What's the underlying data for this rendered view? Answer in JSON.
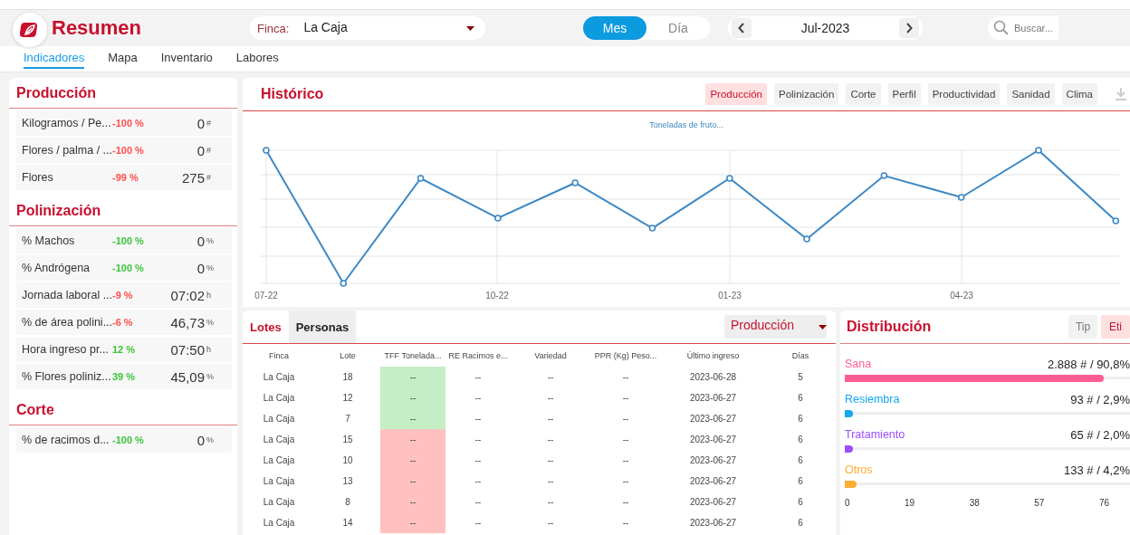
{
  "header": {
    "title": "Resumen",
    "finca": {
      "label": "Finca:",
      "value": "La Caja"
    },
    "period_toggle": [
      {
        "label": "Mes",
        "selected": true
      },
      {
        "label": "Día",
        "selected": false
      }
    ],
    "date": "Jul-2023",
    "search": {
      "placeholder": "Buscar..."
    }
  },
  "tabs": [
    {
      "label": "Indicadores",
      "selected": true
    },
    {
      "label": "Mapa",
      "selected": false
    },
    {
      "label": "Inventario",
      "selected": false
    },
    {
      "label": "Labores",
      "selected": false
    }
  ],
  "indicator_sections": [
    {
      "title": "Producción",
      "items": [
        {
          "label": "Kilogramos / Pe...",
          "change": "-100 %",
          "color": "#ff4d4f",
          "value": "0",
          "unit": "#"
        },
        {
          "label": "Flores / palma / ...",
          "change": "-100 %",
          "color": "#ff4d4f",
          "value": "0",
          "unit": "#"
        },
        {
          "label": "Flores",
          "change": "-99 %",
          "color": "#ff4d4f",
          "value": "275",
          "unit": "#"
        }
      ]
    },
    {
      "title": "Polinización",
      "items": [
        {
          "label": "% Machos",
          "change": "-100 %",
          "color": "#3cc43c",
          "value": "0",
          "unit": "%"
        },
        {
          "label": "% Andrógena",
          "change": "-100 %",
          "color": "#3cc43c",
          "value": "0",
          "unit": "%"
        },
        {
          "label": "Jornada laboral ...",
          "change": "-9 %",
          "color": "#ff4d4f",
          "value": "07:02",
          "unit": "h"
        },
        {
          "label": "% de área polini...",
          "change": "-6 %",
          "color": "#ff4d4f",
          "value": "46,73",
          "unit": "%"
        },
        {
          "label": "Hora ingreso pr...",
          "change": "12 %",
          "color": "#3cc43c",
          "value": "07:50",
          "unit": "h"
        },
        {
          "label": "% Flores poliniz...",
          "change": "39 %",
          "color": "#3cc43c",
          "value": "45,09",
          "unit": "%"
        }
      ]
    },
    {
      "title": "Corte",
      "items": [
        {
          "label": "% de racimos d...",
          "change": "-100 %",
          "color": "#3cc43c",
          "value": "0",
          "unit": "%"
        }
      ]
    }
  ],
  "historico": {
    "title": "Histórico",
    "buttons": [
      {
        "label": "Producción",
        "selected": true
      },
      {
        "label": "Polinización",
        "selected": false
      },
      {
        "label": "Corte",
        "selected": false
      },
      {
        "label": "Perfil",
        "selected": false
      },
      {
        "label": "Productividad",
        "selected": false
      },
      {
        "label": "Sanidad",
        "selected": false
      },
      {
        "label": "Clima",
        "selected": false
      }
    ],
    "chart_title": "Toneladas de fruto...",
    "x_labels": [
      "07-22",
      "10-22",
      "01-23",
      "04-23"
    ]
  },
  "lotes": {
    "tabs": [
      {
        "label": "Lotes",
        "selected": true
      },
      {
        "label": "Personas",
        "selected": false
      }
    ],
    "dropdown": "Producción",
    "columns": [
      "Finca",
      "Lote",
      "TFF Tonelada...",
      "RE Racimos e...",
      "Variedad",
      "PPR (Kg) Peso...",
      "Último ingreso",
      "Días"
    ],
    "rows": [
      {
        "cells": [
          "La Caja",
          "18",
          "--",
          "--",
          "--",
          "--",
          "2023-06-28",
          "5"
        ],
        "color": "#c6eec4"
      },
      {
        "cells": [
          "La Caja",
          "12",
          "--",
          "--",
          "--",
          "--",
          "2023-06-27",
          "6"
        ],
        "color": "#c6eec4"
      },
      {
        "cells": [
          "La Caja",
          "7",
          "--",
          "--",
          "--",
          "--",
          "2023-06-27",
          "6"
        ],
        "color": "#c6eec4"
      },
      {
        "cells": [
          "La Caja",
          "15",
          "--",
          "--",
          "--",
          "--",
          "2023-06-27",
          "6"
        ],
        "color": "#ffc0c0"
      },
      {
        "cells": [
          "La Caja",
          "10",
          "--",
          "--",
          "--",
          "--",
          "2023-06-27",
          "6"
        ],
        "color": "#ffc0c0"
      },
      {
        "cells": [
          "La Caja",
          "13",
          "--",
          "--",
          "--",
          "--",
          "2023-06-27",
          "6"
        ],
        "color": "#ffc0c0"
      },
      {
        "cells": [
          "La Caja",
          "8",
          "--",
          "--",
          "--",
          "--",
          "2023-06-27",
          "6"
        ],
        "color": "#ffc0c0"
      },
      {
        "cells": [
          "La Caja",
          "14",
          "--",
          "--",
          "--",
          "--",
          "2023-06-27",
          "6"
        ],
        "color": "#ffc0c0"
      }
    ]
  },
  "distribucion": {
    "title": "Distribución",
    "buttons": [
      {
        "label": "Tip",
        "selected": false
      },
      {
        "label": "Eti",
        "selected": true
      }
    ],
    "items": [
      {
        "name": "Sana",
        "reading": "2.888 # / 90,8%",
        "level": 0.908,
        "color": "#ff5c93"
      },
      {
        "name": "Resiembra",
        "reading": "93 # / 2,9%",
        "level": 0.029,
        "color": "#13a8f0"
      },
      {
        "name": "Tratamiento",
        "reading": "65 # / 2,0%",
        "level": 0.02,
        "color": "#9b4dff"
      },
      {
        "name": "Otros",
        "reading": "133 # / 4,2%",
        "level": 0.042,
        "color": "#ffad33"
      }
    ],
    "axis_labels": [
      "0",
      "19",
      "38",
      "57",
      "76"
    ]
  }
}
